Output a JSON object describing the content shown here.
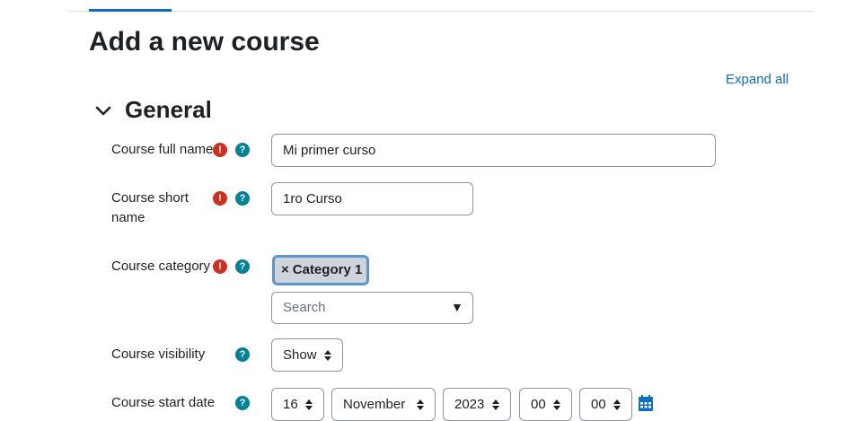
{
  "page": {
    "title": "Add a new course",
    "expand_all": "Expand all"
  },
  "section": {
    "title": "General"
  },
  "colors": {
    "accent": "#0f6cbf",
    "required": "#ca3120",
    "help": "#008196"
  },
  "fields": {
    "full_name": {
      "label": "Course full name",
      "value": "Mi primer curso"
    },
    "short_name": {
      "label_line1": "Course short",
      "label_line2": "name",
      "value": "1ro Curso"
    },
    "category": {
      "label": "Course category",
      "chip_remove": "×",
      "chip_label": "Category 1",
      "search_placeholder": "Search",
      "dropdown_arrow": "▼"
    },
    "visibility": {
      "label": "Course visibility",
      "value": "Show"
    },
    "start_date": {
      "label": "Course start date",
      "day": "16",
      "month": "November",
      "year": "2023",
      "hour": "00",
      "minute": "00"
    }
  },
  "icons": {
    "required": "!",
    "help": "?",
    "calendar": "calendar-icon",
    "collapse": "chevron-down-icon"
  }
}
